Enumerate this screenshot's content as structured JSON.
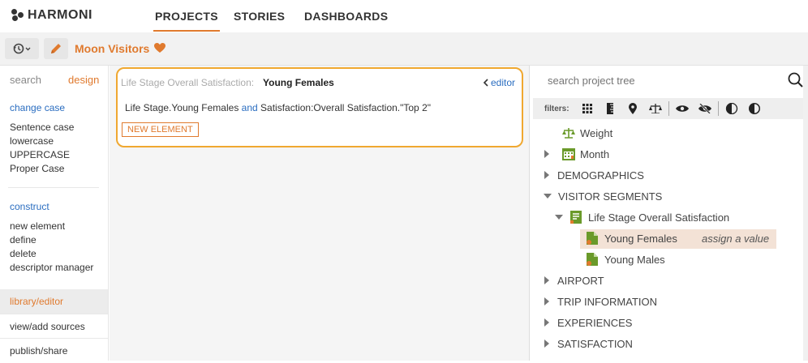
{
  "brand": {
    "name": "HARMONI"
  },
  "nav": {
    "tabs": [
      "PROJECTS",
      "STORIES",
      "DASHBOARDS"
    ],
    "active": "PROJECTS"
  },
  "toolbar": {
    "project_title": "Moon Visitors",
    "favorite_icon": "heart-icon",
    "history_icon": "history-icon",
    "edit_icon": "pencil-icon"
  },
  "sidebar": {
    "tabs": {
      "search": "search",
      "design": "design"
    },
    "change_case": {
      "heading": "change case",
      "items": [
        "Sentence case",
        "lowercase",
        "UPPERCASE",
        "Proper Case"
      ]
    },
    "construct": {
      "heading": "construct",
      "items": [
        "new element",
        "define",
        "delete",
        "descriptor manager"
      ]
    },
    "rows": [
      "library/editor",
      "view/add sources",
      "publish/share"
    ],
    "active_row": "library/editor"
  },
  "editor": {
    "label": "Life Stage Overall Satisfaction:",
    "name": "Young Females",
    "editor_link": "editor",
    "expression": {
      "part1": "Life Stage.Young Females",
      "kw": "and",
      "part2": "Satisfaction:Overall Satisfaction.\"Top 2\""
    },
    "new_element_label": "NEW ELEMENT"
  },
  "tree": {
    "search_placeholder": "search project tree",
    "filters_label": "filters:",
    "filter_icons": [
      "grid-icon",
      "ruler-icon",
      "location-pin-icon",
      "scale-icon",
      "eye-icon",
      "eye-off-icon",
      "contrast-icon",
      "contrast-filled-icon"
    ],
    "items": [
      {
        "label": "Weight",
        "kind": "leaf",
        "icon": "scale-icon"
      },
      {
        "label": "Month",
        "kind": "collapsed",
        "icon": "calendar-icon"
      },
      {
        "label": "DEMOGRAPHICS",
        "kind": "collapsed"
      },
      {
        "label": "VISITOR SEGMENTS",
        "kind": "expanded"
      },
      {
        "label": "Life Stage Overall Satisfaction",
        "kind": "expanded",
        "icon": "list-icon"
      },
      {
        "label": "Young Females",
        "kind": "leaf",
        "icon": "segment-icon",
        "selected": true,
        "hint": "assign a value"
      },
      {
        "label": "Young Males",
        "kind": "leaf",
        "icon": "segment-icon"
      },
      {
        "label": "AIRPORT",
        "kind": "collapsed"
      },
      {
        "label": "TRIP INFORMATION",
        "kind": "collapsed"
      },
      {
        "label": "EXPERIENCES",
        "kind": "collapsed"
      },
      {
        "label": "SATISFACTION",
        "kind": "collapsed"
      }
    ]
  },
  "colors": {
    "accent": "#e07a2e",
    "link": "#2a6dc0",
    "highlight": "#f3e2d6",
    "card_border": "#f0a830"
  }
}
